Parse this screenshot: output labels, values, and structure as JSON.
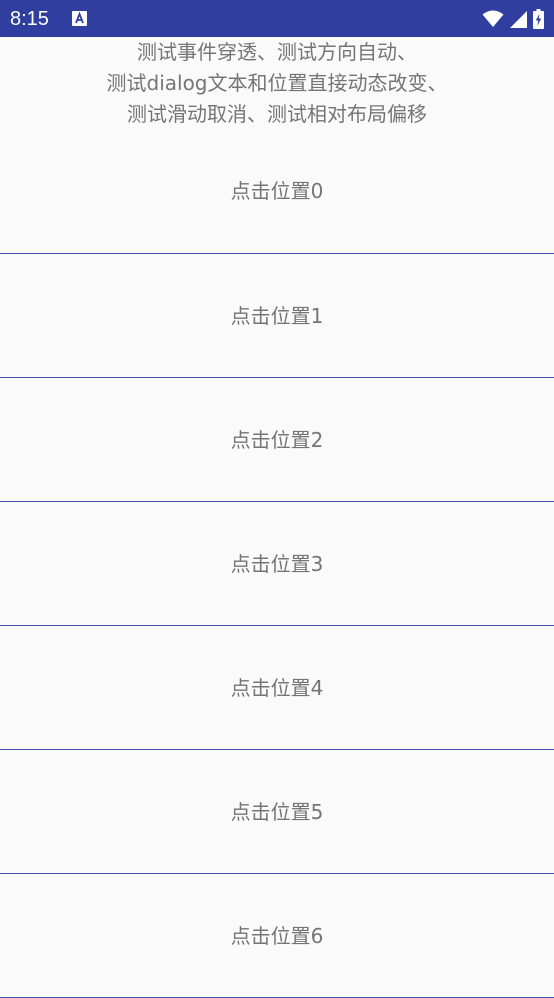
{
  "status_bar": {
    "time": "8:15",
    "notification_icon": "font-a-icon",
    "wifi_icon": "wifi-icon",
    "signal_icon": "cell-signal-icon",
    "battery_icon": "battery-charging-icon",
    "background_color": "#303f9f"
  },
  "header": {
    "lines": [
      "测试事件穿透、测试方向自动、",
      "测试dialog文本和位置直接动态改变、",
      "测试滑动取消、测试相对布局偏移"
    ]
  },
  "list": {
    "items": [
      {
        "label": "点击位置0"
      },
      {
        "label": "点击位置1"
      },
      {
        "label": "点击位置2"
      },
      {
        "label": "点击位置3"
      },
      {
        "label": "点击位置4"
      },
      {
        "label": "点击位置5"
      },
      {
        "label": "点击位置6"
      }
    ],
    "divider_color": "#3f51b5",
    "text_color": "#757575"
  }
}
